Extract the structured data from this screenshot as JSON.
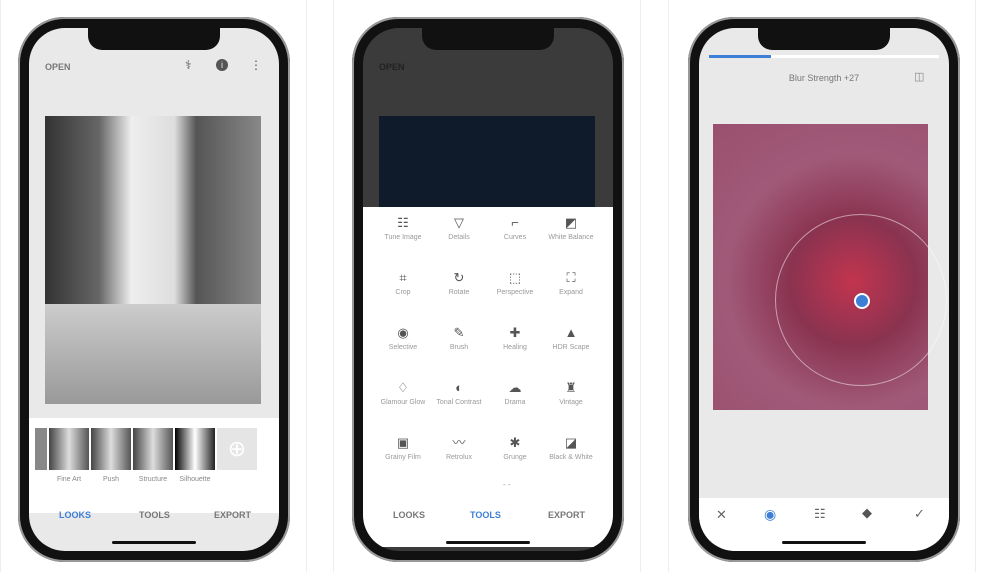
{
  "screen1": {
    "open_label": "OPEN",
    "icons": [
      "heal-icon",
      "info-icon",
      "more-icon"
    ],
    "looks": [
      "Fine Art",
      "Push",
      "Structure",
      "Silhouette"
    ],
    "tabs": [
      "LOOKS",
      "TOOLS",
      "EXPORT"
    ],
    "active_tab": "LOOKS"
  },
  "screen2": {
    "open_label": "OPEN",
    "tools": [
      {
        "label": "Tune Image",
        "icon": "☷"
      },
      {
        "label": "Details",
        "icon": "▽"
      },
      {
        "label": "Curves",
        "icon": "⌐"
      },
      {
        "label": "White Balance",
        "icon": "◩"
      },
      {
        "label": "Crop",
        "icon": "⌗"
      },
      {
        "label": "Rotate",
        "icon": "↻"
      },
      {
        "label": "Perspective",
        "icon": "⬚"
      },
      {
        "label": "Expand",
        "icon": "⛶"
      },
      {
        "label": "Selective",
        "icon": "◉"
      },
      {
        "label": "Brush",
        "icon": "✎"
      },
      {
        "label": "Healing",
        "icon": "✚"
      },
      {
        "label": "HDR Scape",
        "icon": "▲"
      },
      {
        "label": "Glamour Glow",
        "icon": "♢"
      },
      {
        "label": "Tonal Contrast",
        "icon": "◐"
      },
      {
        "label": "Drama",
        "icon": "☁"
      },
      {
        "label": "Vintage",
        "icon": "♜"
      },
      {
        "label": "Grainy Film",
        "icon": "▣"
      },
      {
        "label": "Retrolux",
        "icon": "〰"
      },
      {
        "label": "Grunge",
        "icon": "✱"
      },
      {
        "label": "Black & White",
        "icon": "◪"
      }
    ],
    "tabs": [
      "LOOKS",
      "TOOLS",
      "EXPORT"
    ],
    "active_tab": "TOOLS"
  },
  "screen3": {
    "label": "Blur Strength +27",
    "progress": 0.27,
    "bottom_icons": [
      "close-icon",
      "selective-point-icon",
      "adjust-icon",
      "styles-icon",
      "check-icon"
    ]
  },
  "colors": {
    "accent": "#3d7fd6",
    "pink": "#a14a6c"
  }
}
